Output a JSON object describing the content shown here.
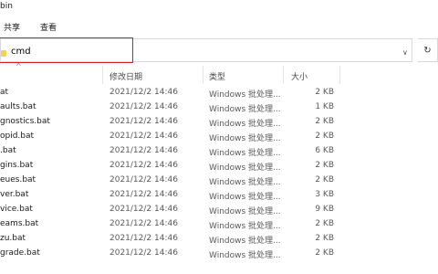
{
  "window": {
    "title": "bin"
  },
  "ribbon": {
    "tabs": [
      "共享",
      "查看"
    ]
  },
  "address": {
    "value": "cmd",
    "dropdown": "∨",
    "refresh": "↻"
  },
  "columns": {
    "sort_arrow": "^",
    "modified": "修改日期",
    "type": "类型",
    "size": "大小"
  },
  "files": [
    {
      "name": "at",
      "modified": "2021/12/2 14:46",
      "type": "Windows 批处理...",
      "size": "2 KB"
    },
    {
      "name": "aults.bat",
      "modified": "2021/12/2 14:46",
      "type": "Windows 批处理...",
      "size": "1 KB"
    },
    {
      "name": "gnostics.bat",
      "modified": "2021/12/2 14:46",
      "type": "Windows 批处理...",
      "size": "2 KB"
    },
    {
      "name": "opid.bat",
      "modified": "2021/12/2 14:46",
      "type": "Windows 批处理...",
      "size": "2 KB"
    },
    {
      "name": ".bat",
      "modified": "2021/12/2 14:46",
      "type": "Windows 批处理...",
      "size": "6 KB"
    },
    {
      "name": "gins.bat",
      "modified": "2021/12/2 14:46",
      "type": "Windows 批处理...",
      "size": "2 KB"
    },
    {
      "name": "eues.bat",
      "modified": "2021/12/2 14:46",
      "type": "Windows 批处理...",
      "size": "2 KB"
    },
    {
      "name": "ver.bat",
      "modified": "2021/12/2 14:46",
      "type": "Windows 批处理...",
      "size": "3 KB"
    },
    {
      "name": "vice.bat",
      "modified": "2021/12/2 14:46",
      "type": "Windows 批处理...",
      "size": "9 KB"
    },
    {
      "name": "eams.bat",
      "modified": "2021/12/2 14:46",
      "type": "Windows 批处理...",
      "size": "2 KB"
    },
    {
      "name": "zu.bat",
      "modified": "2021/12/2 14:46",
      "type": "Windows 批处理...",
      "size": "2 KB"
    },
    {
      "name": "grade.bat",
      "modified": "2021/12/2 14:46",
      "type": "Windows 批处理...",
      "size": "2 KB"
    }
  ],
  "colors": {
    "highlight": "#d71c2a",
    "folder": "#f6cf57"
  },
  "icons": {
    "address_folder": "folder-icon"
  }
}
